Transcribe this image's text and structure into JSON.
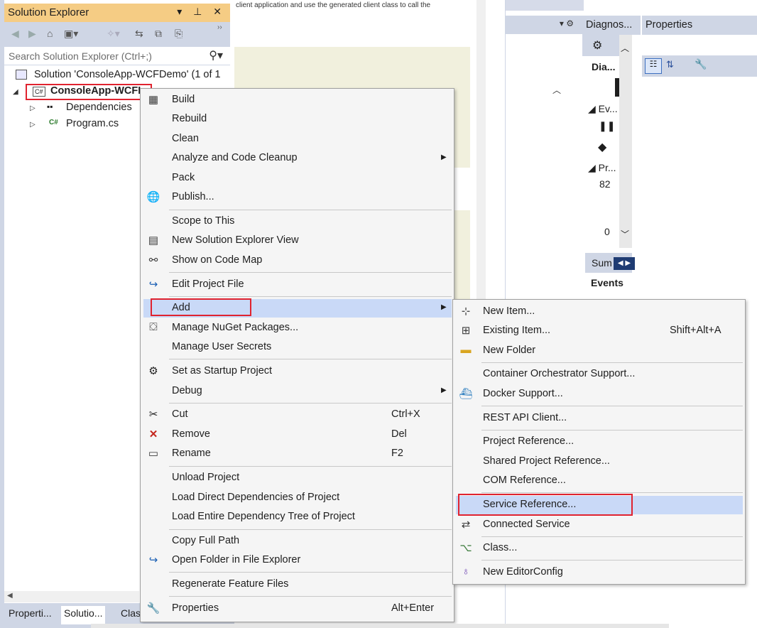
{
  "solution_explorer": {
    "title": "Solution Explorer",
    "title_buttons": "▾ ⊥ ✕",
    "search_placeholder": "Search Solution Explorer (Ctrl+;)",
    "solution_label": "Solution 'ConsoleApp-WCFDemo' (1 of 1",
    "project_label": "ConsoleApp-WCFI",
    "tree": [
      {
        "label": "Dependencies",
        "icon": "dependencies-icon"
      },
      {
        "label": "Program.cs",
        "icon": "csharp-file-icon"
      }
    ],
    "bottom_tabs": [
      "Properti...",
      "Solutio...",
      "Clas"
    ]
  },
  "editor": {
    "top_text": "client application and use the generated client class to call the"
  },
  "diagnostics": {
    "title": "Diagnos...",
    "items": [
      "Dia...",
      "Ev...",
      "Pr...",
      "82",
      "0",
      "Sum",
      "Events"
    ]
  },
  "properties": {
    "title": "Properties"
  },
  "context_menu": {
    "items": [
      {
        "label": "Build",
        "icon": "build-icon"
      },
      {
        "label": "Rebuild"
      },
      {
        "label": "Clean"
      },
      {
        "label": "Analyze and Code Cleanup",
        "submenu": true
      },
      {
        "label": "Pack"
      },
      {
        "label": "Publish...",
        "icon": "publish-icon"
      },
      {
        "label": "Scope to This"
      },
      {
        "label": "New Solution Explorer View",
        "icon": "new-view-icon"
      },
      {
        "label": "Show on Code Map",
        "icon": "code-map-icon"
      },
      {
        "label": "Edit Project File",
        "icon": "edit-project-icon"
      },
      {
        "label": "Add",
        "submenu": true,
        "highlighted": true
      },
      {
        "label": "Manage NuGet Packages...",
        "icon": "nuget-icon"
      },
      {
        "label": "Manage User Secrets"
      },
      {
        "label": "Set as Startup Project",
        "icon": "gear-icon"
      },
      {
        "label": "Debug",
        "submenu": true
      },
      {
        "label": "Cut",
        "shortcut": "Ctrl+X",
        "icon": "cut-icon"
      },
      {
        "label": "Remove",
        "shortcut": "Del",
        "icon": "remove-icon"
      },
      {
        "label": "Rename",
        "shortcut": "F2",
        "icon": "rename-icon"
      },
      {
        "label": "Unload Project"
      },
      {
        "label": "Load Direct Dependencies of Project"
      },
      {
        "label": "Load Entire Dependency Tree of Project"
      },
      {
        "label": "Copy Full Path"
      },
      {
        "label": "Open Folder in File Explorer",
        "icon": "open-folder-icon"
      },
      {
        "label": "Regenerate Feature Files"
      },
      {
        "label": "Properties",
        "shortcut": "Alt+Enter",
        "icon": "wrench-icon"
      }
    ]
  },
  "add_submenu": {
    "items": [
      {
        "label": "New Item...",
        "icon": "new-item-icon"
      },
      {
        "label": "Existing Item...",
        "shortcut": "Shift+Alt+A",
        "icon": "existing-item-icon"
      },
      {
        "label": "New Folder",
        "icon": "new-folder-icon"
      },
      {
        "label": "Container Orchestrator Support..."
      },
      {
        "label": "Docker Support...",
        "icon": "docker-icon"
      },
      {
        "label": "REST API Client..."
      },
      {
        "label": "Project Reference..."
      },
      {
        "label": "Shared Project Reference..."
      },
      {
        "label": "COM Reference..."
      },
      {
        "label": "Service Reference...",
        "highlighted": true
      },
      {
        "label": "Connected Service",
        "icon": "connected-service-icon"
      },
      {
        "label": "Class...",
        "icon": "class-icon"
      },
      {
        "label": "New EditorConfig",
        "icon": "lightbulb-icon"
      }
    ]
  },
  "colors": {
    "title_active": "#f5cc84",
    "chrome": "#cfd6e5",
    "menu_bg": "#f5f5f5",
    "highlight": "#c9d9f7",
    "annotation_red": "#e0232f"
  }
}
